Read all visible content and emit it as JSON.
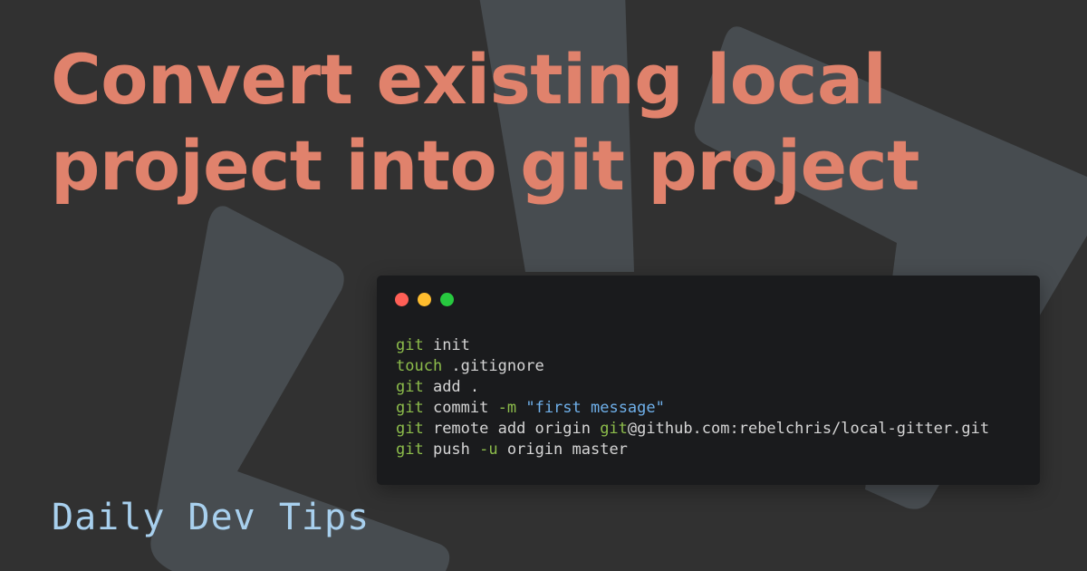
{
  "colors": {
    "background": "#313131",
    "shape": "#474c50",
    "title": "#e0826c",
    "code_bg": "#1a1b1d",
    "code_text": "#d5d5d5",
    "command": "#8dbd4b",
    "flag": "#8dbd4b",
    "string": "#6fb0ea",
    "brand": "#a8d0ee",
    "dot_red": "#ff5f56",
    "dot_yellow": "#ffbd2e",
    "dot_green": "#27c93f"
  },
  "title": {
    "line1": "Convert existing local",
    "line2": "project into git project"
  },
  "code_window": {
    "controls": [
      "close",
      "minimize",
      "maximize"
    ],
    "lines": [
      [
        {
          "t": "git",
          "k": "cmd"
        },
        {
          "t": " init",
          "k": "plain"
        }
      ],
      [
        {
          "t": "touch",
          "k": "cmd"
        },
        {
          "t": " .gitignore",
          "k": "plain"
        }
      ],
      [
        {
          "t": "git",
          "k": "cmd"
        },
        {
          "t": " add .",
          "k": "plain"
        }
      ],
      [
        {
          "t": "git",
          "k": "cmd"
        },
        {
          "t": " commit ",
          "k": "plain"
        },
        {
          "t": "-m",
          "k": "flag"
        },
        {
          "t": " ",
          "k": "plain"
        },
        {
          "t": "\"first message\"",
          "k": "str"
        }
      ],
      [
        {
          "t": "git",
          "k": "cmd"
        },
        {
          "t": " remote add origin ",
          "k": "plain"
        },
        {
          "t": "git",
          "k": "cmd"
        },
        {
          "t": "@github.com:rebelchris/local-gitter.git",
          "k": "plain"
        }
      ],
      [
        {
          "t": "git",
          "k": "cmd"
        },
        {
          "t": " push ",
          "k": "plain"
        },
        {
          "t": "-u",
          "k": "flag"
        },
        {
          "t": " origin master",
          "k": "plain"
        }
      ]
    ]
  },
  "brand": {
    "name": "Daily Dev Tips"
  }
}
